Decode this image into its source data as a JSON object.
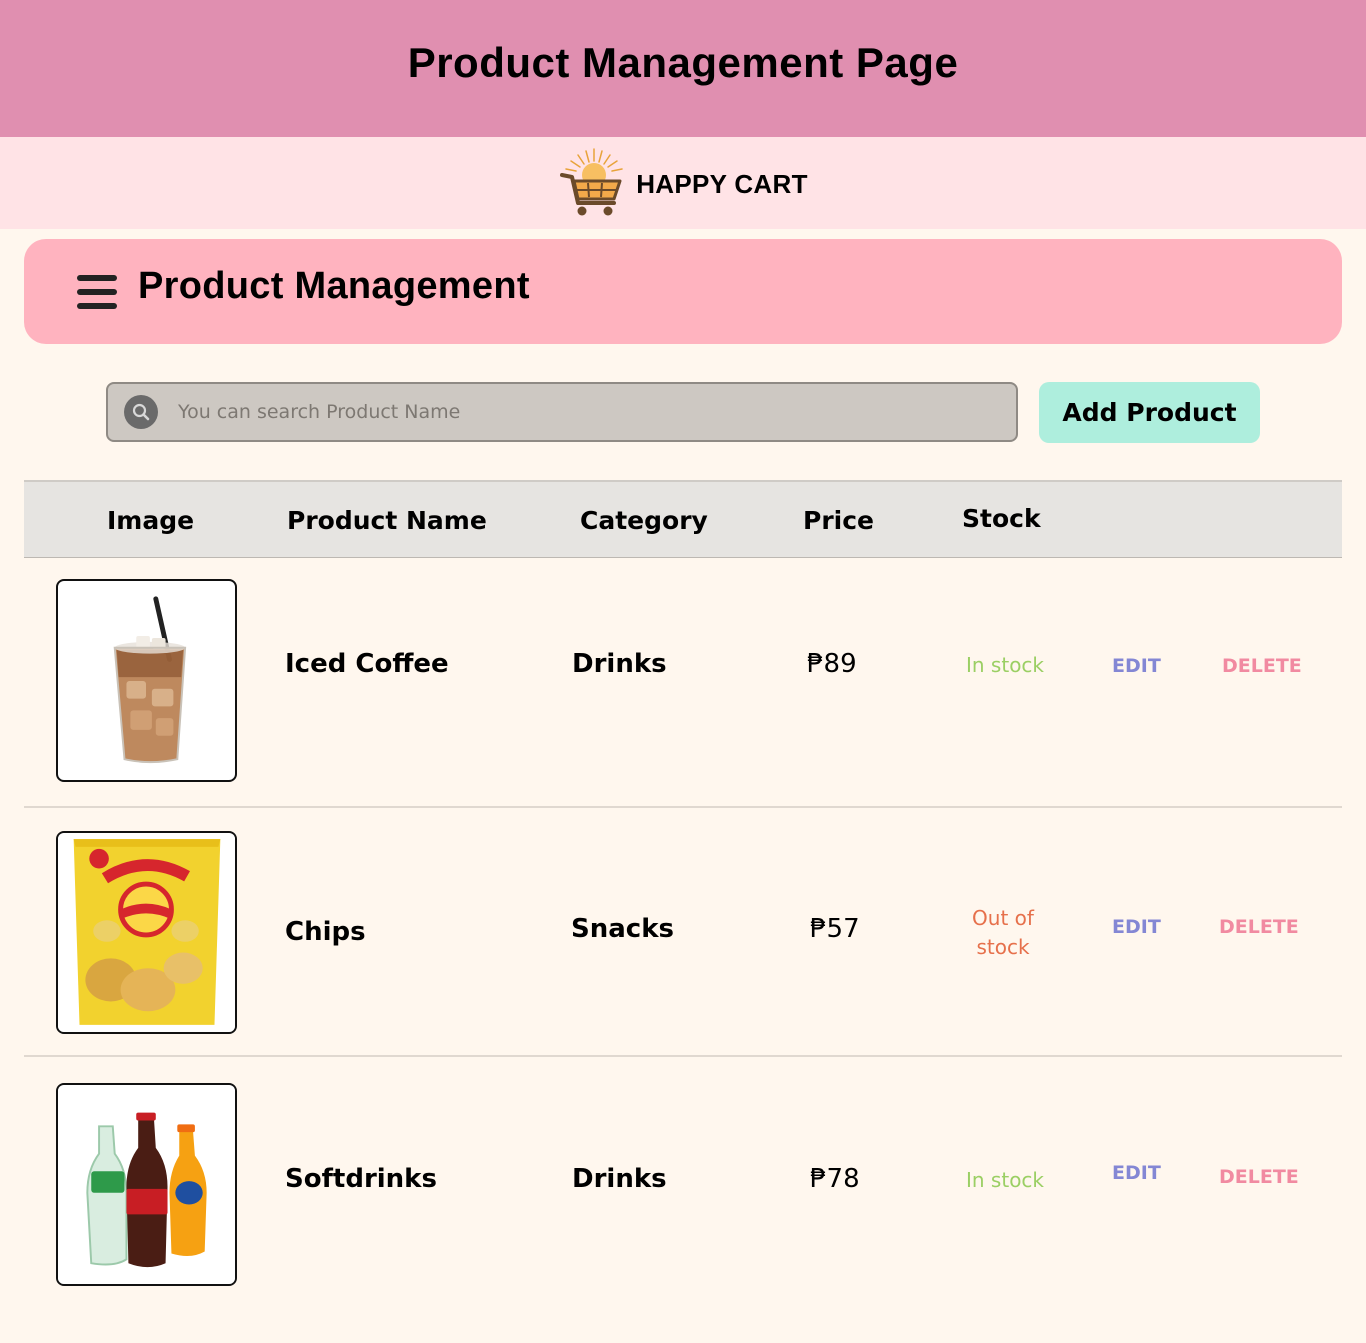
{
  "page_title": "Product Management Page",
  "brand": {
    "name": "HAPPY CART",
    "logo_icon": "shopping-cart-icon"
  },
  "section": {
    "title": "Product Management",
    "menu_icon": "hamburger-menu-icon"
  },
  "search": {
    "placeholder": "You can search Product Name",
    "icon": "search-icon"
  },
  "add_button_label": "Add Product",
  "table": {
    "headers": [
      "Image",
      "Product Name",
      "Category",
      "Price",
      "Stock"
    ],
    "rows": [
      {
        "image": "iced-coffee-image",
        "name": "Iced Coffee",
        "category": "Drinks",
        "price": "₱89",
        "stock": "In stock",
        "edit_label": "EDIT",
        "delete_label": "DELETE"
      },
      {
        "image": "chips-bag-image",
        "name": "Chips",
        "category": "Snacks",
        "price": "₱57",
        "stock": "Out of stock",
        "edit_label": "EDIT",
        "delete_label": "DELETE"
      },
      {
        "image": "softdrinks-bottles-image",
        "name": "Softdrinks",
        "category": "Drinks",
        "price": "₱78",
        "stock": "In stock",
        "edit_label": "EDIT",
        "delete_label": "DELETE"
      }
    ]
  },
  "colors": {
    "top_bar": "#e08fb0",
    "brand_bar": "#ffe3e6",
    "section_header": "#ffb3bf",
    "add_button": "#aeeedd",
    "in_stock": "#9bcf64",
    "out_of_stock": "#e6704b",
    "edit": "#8487d4",
    "delete": "#f18aa1"
  }
}
